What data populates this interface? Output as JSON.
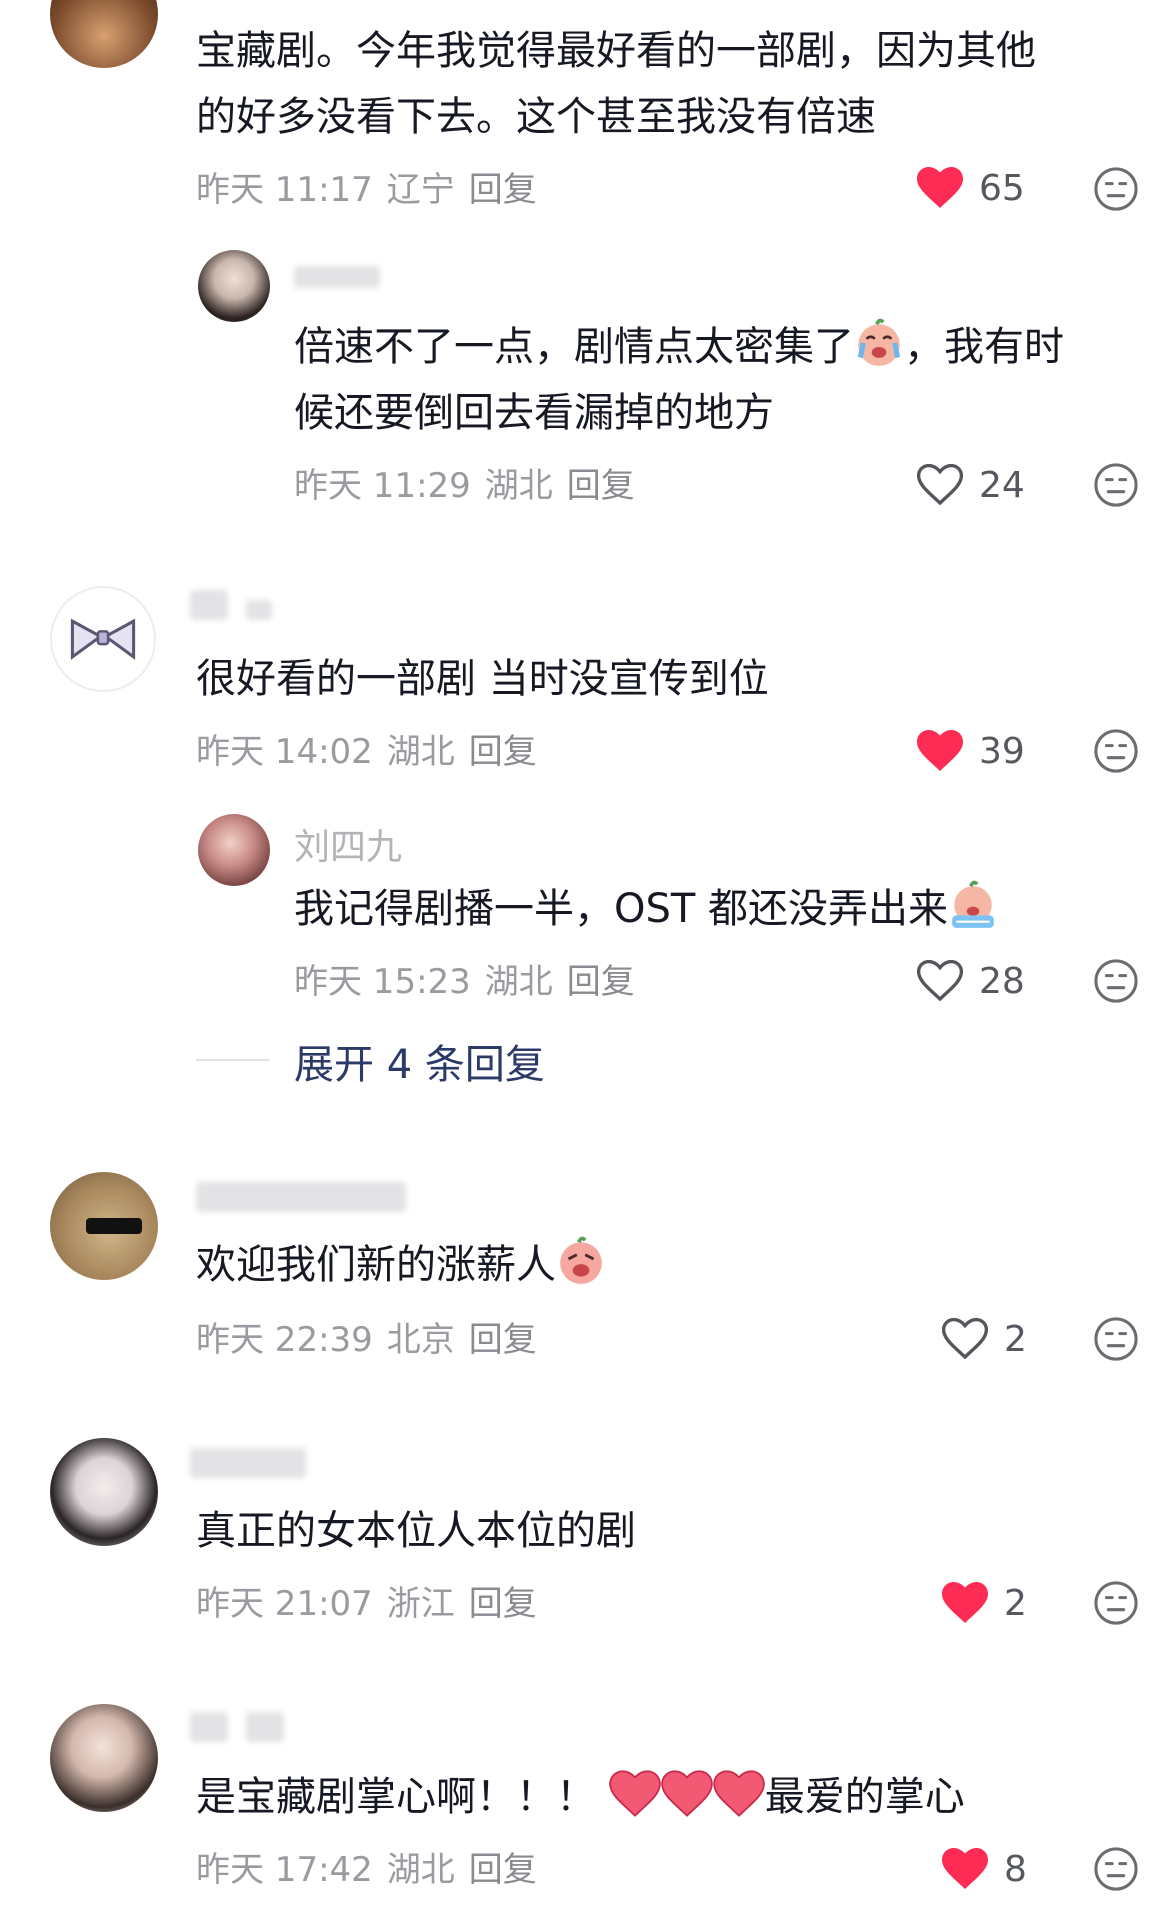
{
  "comments": [
    {
      "text_line1": "宝藏剧。今年我觉得最好看的一部剧，因为其他",
      "text_line2": "的好多没看下去。这个甚至我没有倍速",
      "time": "昨天 11:17",
      "location": "辽宁",
      "reply_label": "回复",
      "likes": "65",
      "liked": true
    },
    {
      "text_a": "倍速不了一点，剧情点太密集了",
      "text_b": "，我有时",
      "text_line2": "候还要倒回去看漏掉的地方",
      "time": "昨天 11:29",
      "location": "湖北",
      "reply_label": "回复",
      "likes": "24",
      "liked": false
    },
    {
      "text_line1": "很好看的一部剧 当时没宣传到位",
      "time": "昨天 14:02",
      "location": "湖北",
      "reply_label": "回复",
      "likes": "39",
      "liked": true
    },
    {
      "username": "刘四九",
      "text_line1": "我记得剧播一半，OST 都还没弄出来",
      "time": "昨天 15:23",
      "location": "湖北",
      "reply_label": "回复",
      "likes": "28",
      "liked": false
    },
    {
      "text_line1": "欢迎我们新的涨薪人",
      "time": "昨天 22:39",
      "location": "北京",
      "reply_label": "回复",
      "likes": "2",
      "liked": false
    },
    {
      "text_line1": "真正的女本位人本位的剧",
      "time": "昨天 21:07",
      "location": "浙江",
      "reply_label": "回复",
      "likes": "2",
      "liked": true
    },
    {
      "text_a": "是宝藏剧掌心啊！！！",
      "text_b": "最爱的掌心",
      "time": "昨天 17:42",
      "location": "湖北",
      "reply_label": "回复",
      "likes": "8",
      "liked": true
    }
  ],
  "expand_replies": "展开 4 条回复",
  "colors": {
    "liked_heart": "#fe2c55",
    "link": "#2b3a67",
    "meta": "#9a9ba0"
  },
  "icons": [
    "heart-icon",
    "heart-outline-icon",
    "dislike-face-icon",
    "crying-emoji",
    "bowtie-avatar"
  ]
}
